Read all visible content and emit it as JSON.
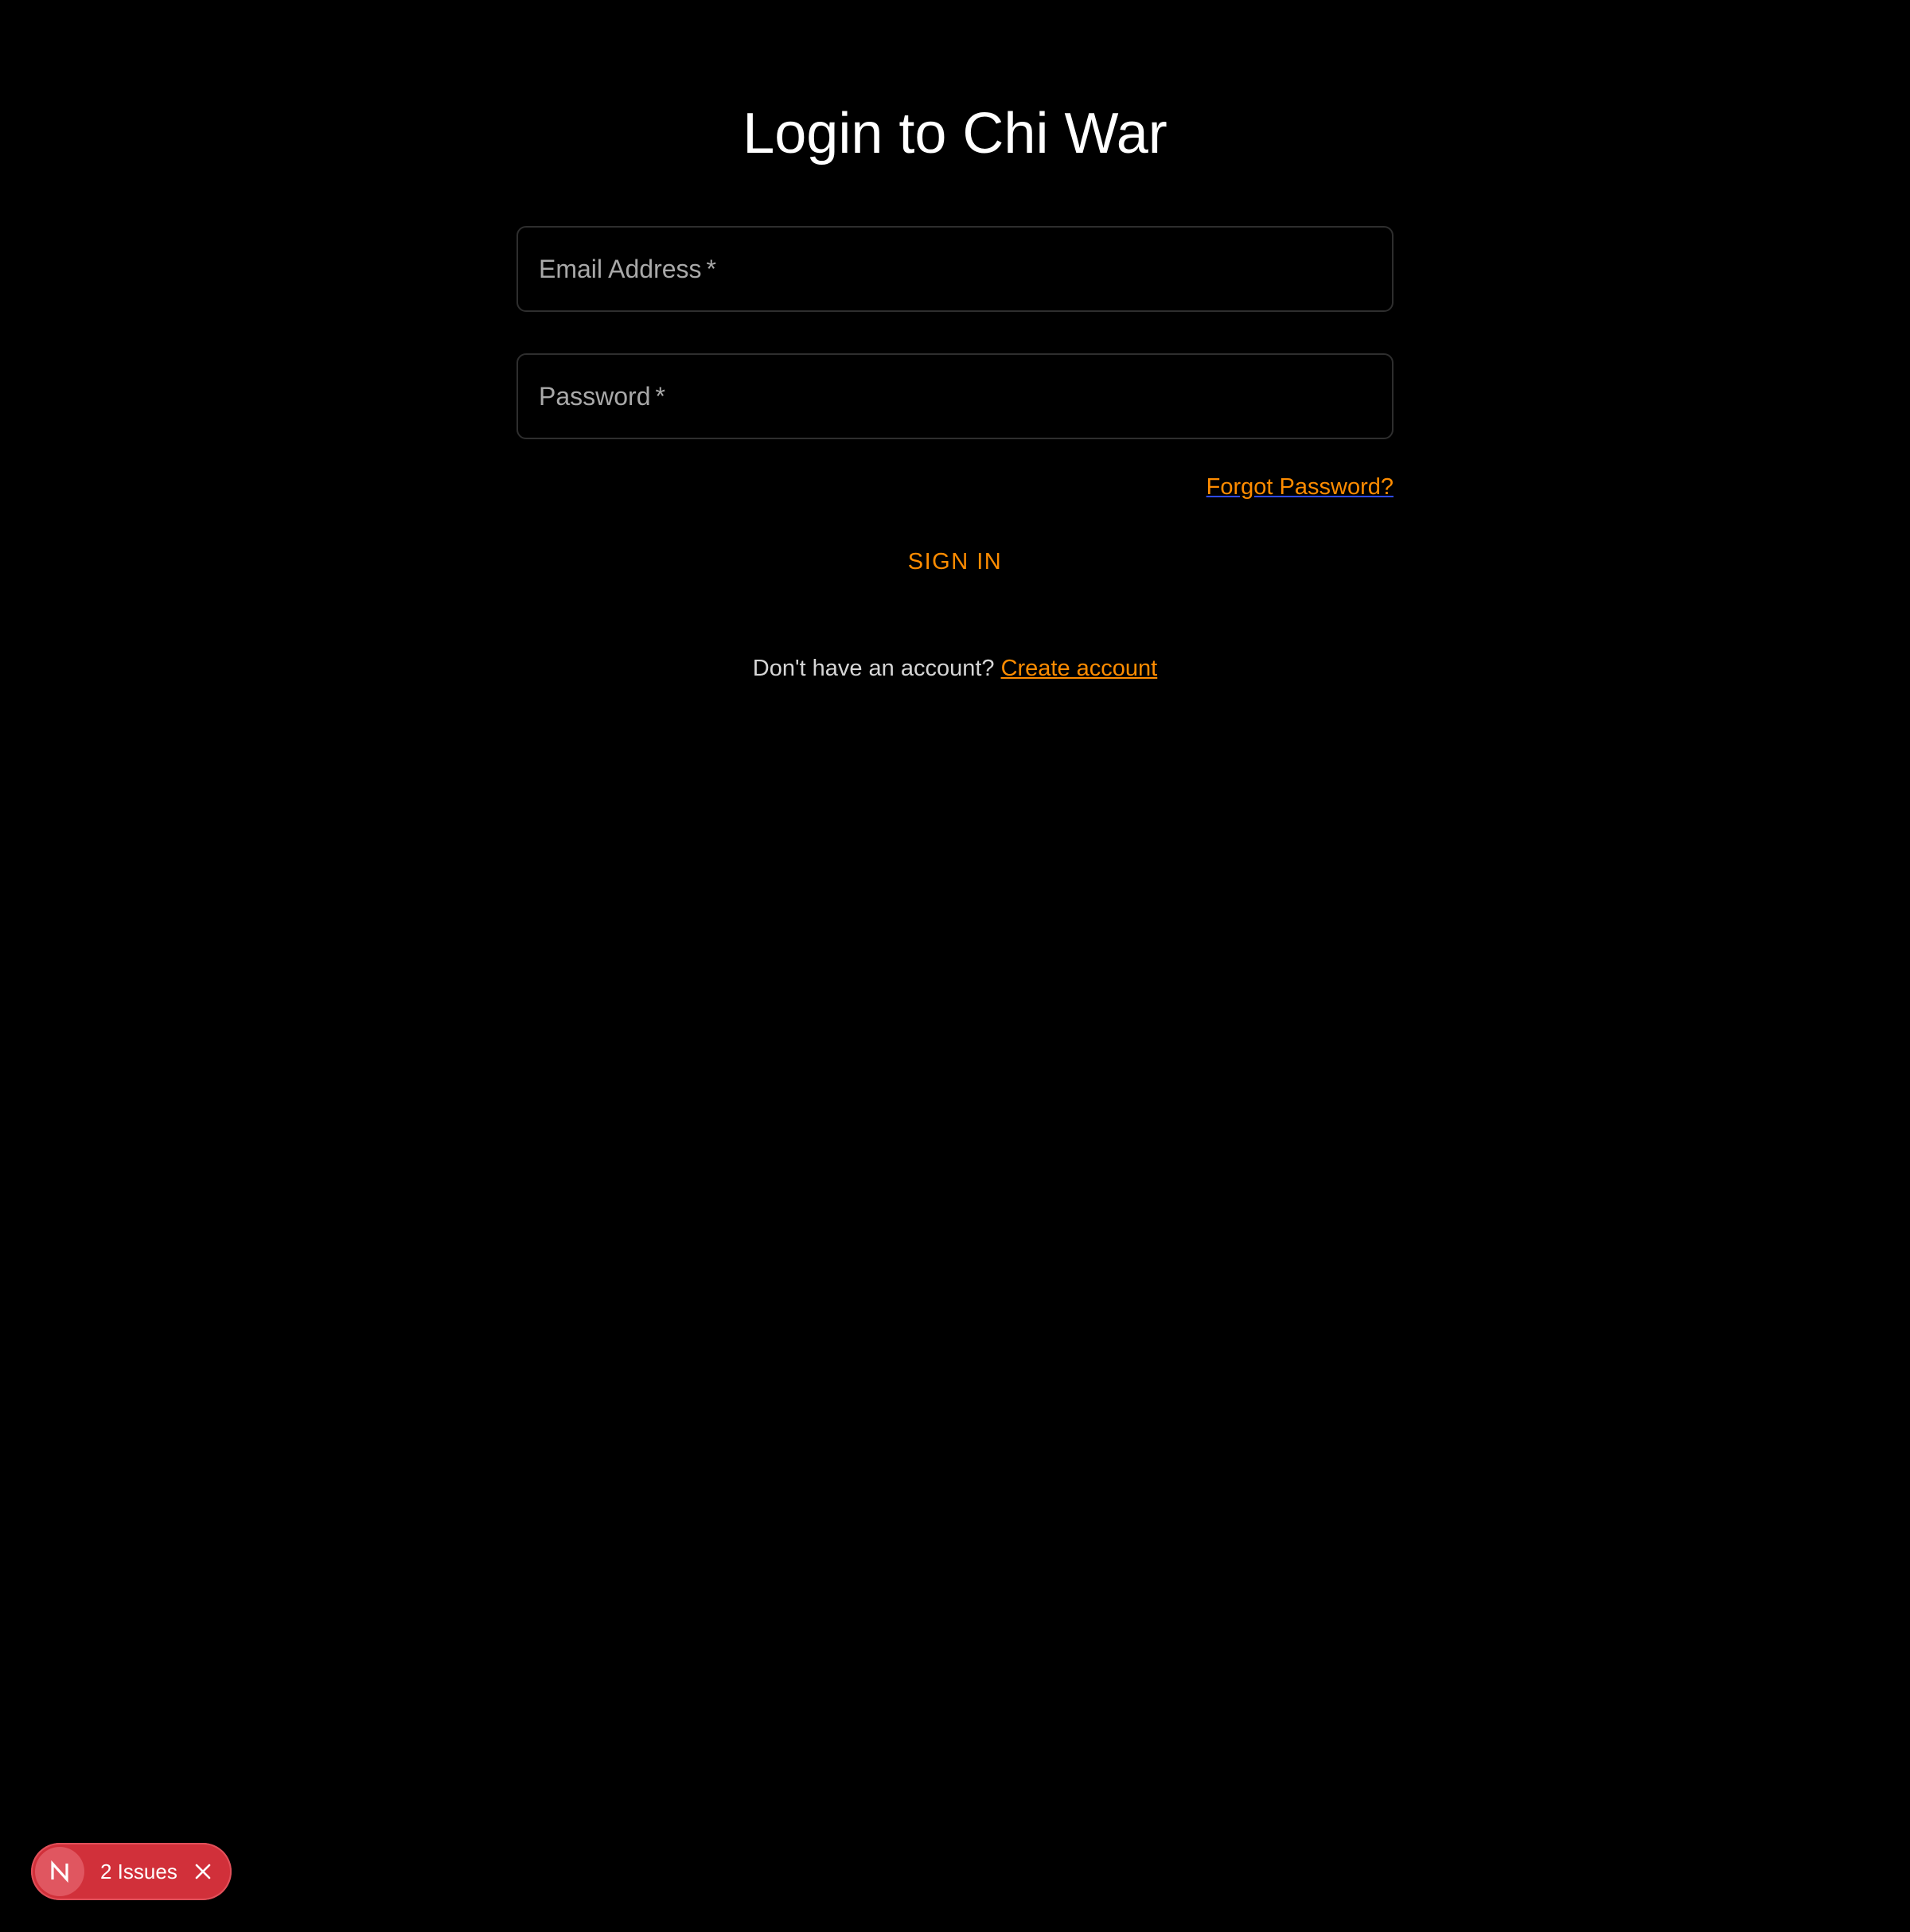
{
  "page": {
    "title": "Login to Chi War"
  },
  "form": {
    "email": {
      "label": "Email Address",
      "required_mark": "*",
      "value": ""
    },
    "password": {
      "label": "Password",
      "required_mark": "*",
      "value": ""
    },
    "forgot_password_link": "Forgot Password?",
    "sign_in_button": "SIGN IN"
  },
  "signup": {
    "prompt": "Don't have an account?",
    "link": "Create account"
  },
  "dev_overlay": {
    "badge_letter": "N",
    "issues_label": "2 Issues",
    "icons": {
      "badge": "nextjs-logo-icon",
      "close": "close-icon"
    }
  },
  "colors": {
    "background": "#000000",
    "accent": "#ff8c00",
    "issues_badge": "#d1303a"
  }
}
